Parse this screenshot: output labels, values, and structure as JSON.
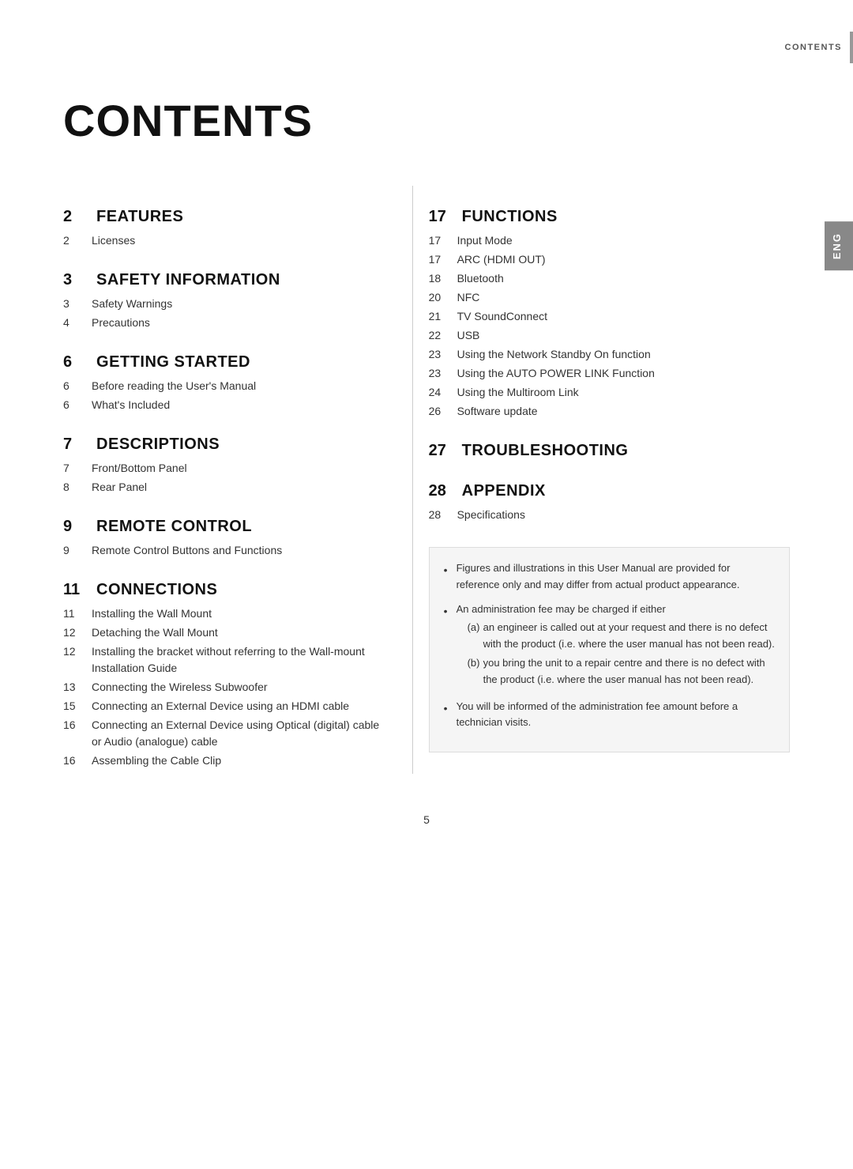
{
  "header": {
    "contents_label": "CONTENTS",
    "eng_label": "ENG"
  },
  "title": "CONTENTS",
  "left_column": [
    {
      "number": "2",
      "title": "FEATURES",
      "items": [
        {
          "num": "2",
          "text": "Licenses"
        }
      ]
    },
    {
      "number": "3",
      "title": "SAFETY INFORMATION",
      "items": [
        {
          "num": "3",
          "text": "Safety Warnings"
        },
        {
          "num": "4",
          "text": "Precautions"
        }
      ]
    },
    {
      "number": "6",
      "title": "GETTING STARTED",
      "items": [
        {
          "num": "6",
          "text": "Before reading the User's Manual"
        },
        {
          "num": "6",
          "text": "What's Included"
        }
      ]
    },
    {
      "number": "7",
      "title": "DESCRIPTIONS",
      "items": [
        {
          "num": "7",
          "text": "Front/Bottom Panel"
        },
        {
          "num": "8",
          "text": "Rear Panel"
        }
      ]
    },
    {
      "number": "9",
      "title": "REMOTE CONTROL",
      "items": [
        {
          "num": "9",
          "text": "Remote Control Buttons and Functions"
        }
      ]
    },
    {
      "number": "11",
      "title": "CONNECTIONS",
      "items": [
        {
          "num": "11",
          "text": "Installing the Wall Mount"
        },
        {
          "num": "12",
          "text": "Detaching the Wall Mount"
        },
        {
          "num": "12",
          "text": "Installing the bracket without referring to the Wall-mount Installation Guide"
        },
        {
          "num": "13",
          "text": "Connecting the Wireless Subwoofer"
        },
        {
          "num": "15",
          "text": "Connecting an External Device using an HDMI cable"
        },
        {
          "num": "16",
          "text": "Connecting an External Device using Optical (digital) cable or Audio (analogue) cable"
        },
        {
          "num": "16",
          "text": "Assembling the Cable Clip"
        }
      ]
    }
  ],
  "right_column": [
    {
      "number": "17",
      "title": "FUNCTIONS",
      "items": [
        {
          "num": "17",
          "text": "Input Mode"
        },
        {
          "num": "17",
          "text": "ARC (HDMI OUT)"
        },
        {
          "num": "18",
          "text": "Bluetooth"
        },
        {
          "num": "20",
          "text": "NFC"
        },
        {
          "num": "21",
          "text": "TV SoundConnect"
        },
        {
          "num": "22",
          "text": "USB"
        },
        {
          "num": "23",
          "text": "Using the Network Standby On function"
        },
        {
          "num": "23",
          "text": "Using the AUTO POWER LINK Function"
        },
        {
          "num": "24",
          "text": "Using the Multiroom Link"
        },
        {
          "num": "26",
          "text": "Software update"
        }
      ]
    },
    {
      "number": "27",
      "title": "TROUBLESHOOTING",
      "items": []
    },
    {
      "number": "28",
      "title": "APPENDIX",
      "items": [
        {
          "num": "28",
          "text": "Specifications"
        }
      ]
    }
  ],
  "notes": [
    {
      "bullet": "•",
      "text": "Figures and illustrations in this User Manual are provided for reference only and may differ from actual product appearance.",
      "sub_items": []
    },
    {
      "bullet": "•",
      "text": "An administration fee may be charged if either",
      "sub_items": [
        {
          "label": "(a)",
          "text": "an engineer is called out at your request and there is no defect with the product (i.e. where the user manual has not been read)."
        },
        {
          "label": "(b)",
          "text": "you bring the unit to a repair centre and there is no defect with the product (i.e. where the user manual has not been read)."
        }
      ]
    },
    {
      "bullet": "•",
      "text": "You will be informed of the administration fee amount before a technician visits.",
      "sub_items": []
    }
  ],
  "page_number": "5"
}
